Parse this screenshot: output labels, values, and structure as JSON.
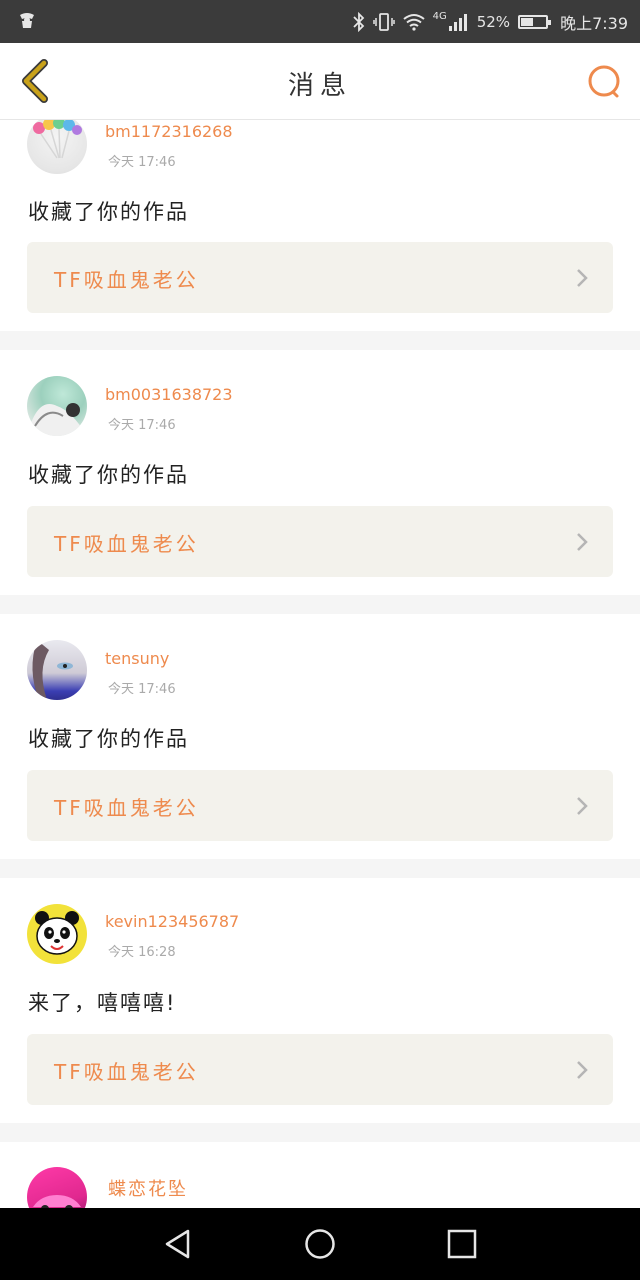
{
  "status_bar": {
    "network": "4G",
    "battery": "52%",
    "battery_level": 0.52,
    "time": "晚上7:39"
  },
  "header": {
    "title": "消息"
  },
  "messages": [
    {
      "username": "bm1172316268",
      "time": "今天 17:46",
      "text": "收藏了你的作品",
      "work": "TF吸血鬼老公"
    },
    {
      "username": "bm0031638723",
      "time": "今天 17:46",
      "text": "收藏了你的作品",
      "work": "TF吸血鬼老公"
    },
    {
      "username": "tensuny",
      "time": "今天 17:46",
      "text": "收藏了你的作品",
      "work": "TF吸血鬼老公"
    },
    {
      "username": "kevin123456787",
      "time": "今天 16:28",
      "text": "来了，嘻嘻嘻!",
      "work": "TF吸血鬼老公"
    },
    {
      "username": "蝶恋花坠"
    }
  ],
  "colors": {
    "accent": "#ee8a4d",
    "back_icon": "#c9a21a",
    "status_bar": "#3b3b3b",
    "link_bg": "#f3f2ec"
  }
}
